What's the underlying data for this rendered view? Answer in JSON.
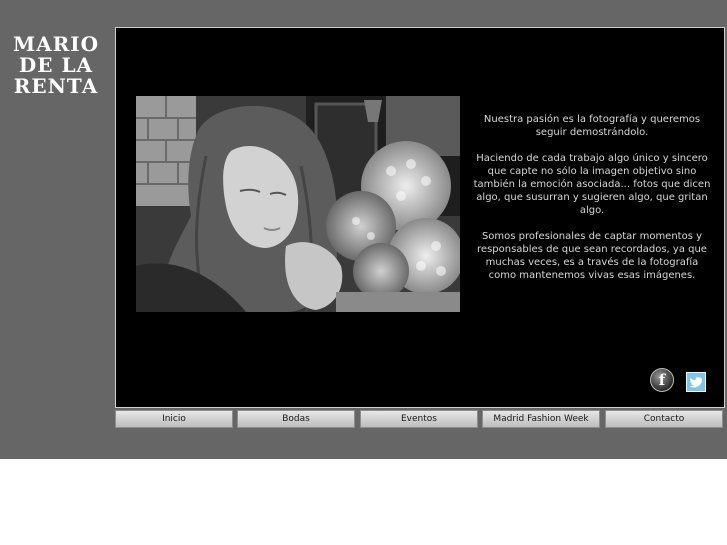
{
  "brand": {
    "line1": "MARIO",
    "line2": "DE LA",
    "line3": "RENTA"
  },
  "intro": {
    "p1": "Nuestra pasión es la fotografía y queremos seguir demostrándolo.",
    "p2": "Haciendo de cada trabajo algo único y sincero que capte no sólo la imagen objetivo sino también la emoción asociada... fotos que dicen algo, que susurran y sugieren algo, que gritan algo.",
    "p3": "Somos profesionales de captar momentos y responsables de que sean recordados, ya que muchas veces, es a través de la fotografía como mantenemos vivas esas imágenes."
  },
  "social": {
    "facebook_glyph": "f",
    "facebook_icon": "facebook-icon",
    "twitter_icon": "twitter-icon"
  },
  "nav": {
    "items": [
      {
        "label": "Inicio"
      },
      {
        "label": "Bodas"
      },
      {
        "label": "Eventos"
      },
      {
        "label": "Madrid Fashion Week"
      },
      {
        "label": "Contacto"
      }
    ]
  },
  "colors": {
    "background_band": "#666666",
    "frame": "#000000",
    "text": "#d8d8d8",
    "twitter": "#7fc6e6"
  }
}
